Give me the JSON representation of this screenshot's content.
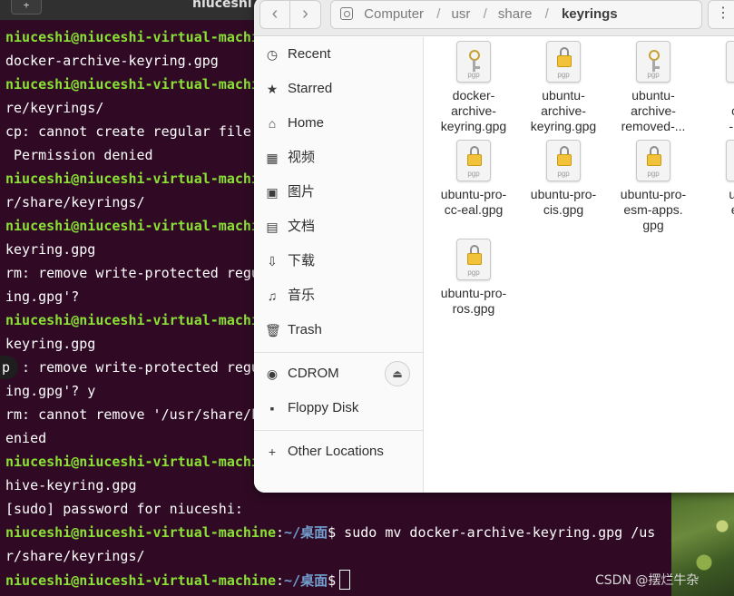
{
  "terminal": {
    "title": "niuceshi",
    "tab_button": "+",
    "lines": [
      {
        "user": "niuceshi@niuceshi-virtual-machi",
        "rest": ""
      },
      {
        "user": "",
        "rest": "docker-archive-keyring.gpg"
      },
      {
        "user": "niuceshi@niuceshi-virtual-machi",
        "rest": ""
      },
      {
        "user": "",
        "rest": "re/keyrings/"
      },
      {
        "user": "",
        "rest": "cp: cannot create regular file"
      },
      {
        "user": "",
        "rest": " Permission denied"
      },
      {
        "user": "niuceshi@niuceshi-virtual-machi",
        "rest": ""
      },
      {
        "user": "",
        "rest": "r/share/keyrings/"
      },
      {
        "user": "niuceshi@niuceshi-virtual-machi",
        "rest": ""
      },
      {
        "user": "",
        "rest": "keyring.gpg"
      },
      {
        "user": "",
        "rest": "rm: remove write-protected regu"
      },
      {
        "user": "",
        "rest": "ing.gpg'?"
      },
      {
        "user": "niuceshi@niuceshi-virtual-machi",
        "rest": ""
      },
      {
        "user": "",
        "rest": "keyring.gpg"
      },
      {
        "user": "",
        "rest": "  : remove write-protected regu"
      },
      {
        "user": "",
        "rest": "ing.gpg'? y"
      },
      {
        "user": "",
        "rest": "rm: cannot remove '/usr/share/k"
      },
      {
        "user": "",
        "rest": "enied"
      },
      {
        "user": "niuceshi@niuceshi-virtual-machi",
        "rest": ""
      },
      {
        "user": "",
        "rest": "hive-keyring.gpg"
      },
      {
        "user": "",
        "rest": "[sudo] password for niuceshi:"
      }
    ],
    "prompt_user": "niuceshi@niuceshi-virtual-machine",
    "prompt_colon": ":",
    "prompt_path": "~/桌面",
    "prompt_symbol": "$",
    "command_line": " sudo mv docker-archive-keyring.gpg /us",
    "command_wrap": "r/share/keyrings/",
    "left_pill_text": "p"
  },
  "files": {
    "path": [
      "Computer",
      "usr",
      "share"
    ],
    "path_current": "keyrings",
    "path_separator": "/",
    "nav_back": "‹",
    "nav_forward": "›",
    "menu_glyph": "⋮",
    "sidebar": [
      {
        "label": "Recent",
        "icon": "clock-icon",
        "glyph": "◷"
      },
      {
        "label": "Starred",
        "icon": "star-icon",
        "glyph": "★"
      },
      {
        "label": "Home",
        "icon": "home-icon",
        "glyph": "⌂"
      },
      {
        "label": "视频",
        "icon": "video-icon",
        "glyph": "▦"
      },
      {
        "label": "图片",
        "icon": "picture-icon",
        "glyph": "▣"
      },
      {
        "label": "文档",
        "icon": "document-icon",
        "glyph": "▤"
      },
      {
        "label": "下载",
        "icon": "download-icon",
        "glyph": "⇩"
      },
      {
        "label": "音乐",
        "icon": "music-icon",
        "glyph": "♫"
      },
      {
        "label": "Trash",
        "icon": "trash-icon",
        "glyph": "🗑"
      }
    ],
    "devices": [
      {
        "label": "CDROM",
        "icon": "disc-icon",
        "glyph": "◉",
        "eject": "⏏"
      },
      {
        "label": "Floppy Disk",
        "icon": "floppy-icon",
        "glyph": "▪"
      }
    ],
    "other_locations": {
      "label": "Other Locations",
      "glyph": "+"
    },
    "file_icon_label": "pgp",
    "items": [
      {
        "name": [
          "docker-",
          "archive-",
          "keyring.gpg"
        ],
        "icon": "key"
      },
      {
        "name": [
          "ubuntu-",
          "archive-",
          "keyring.gpg"
        ],
        "icon": "lock"
      },
      {
        "name": [
          "ubuntu-",
          "archive-",
          "removed-..."
        ],
        "icon": "key"
      },
      {
        "name": [
          "ub",
          "clou",
          "-keyr"
        ],
        "icon": "lock"
      },
      {
        "name": [
          "ubuntu-pro-",
          "cc-eal.gpg"
        ],
        "icon": "lock"
      },
      {
        "name": [
          "ubuntu-pro-",
          "cis.gpg"
        ],
        "icon": "lock"
      },
      {
        "name": [
          "ubuntu-pro-",
          "esm-apps.",
          "gpg"
        ],
        "icon": "lock"
      },
      {
        "name": [
          "ubun",
          "esm",
          "g"
        ],
        "icon": "lock"
      },
      {
        "name": [
          "ubuntu-pro-",
          "ros.gpg"
        ],
        "icon": "lock"
      }
    ]
  },
  "watermark": "CSDN @摆烂牛杂"
}
